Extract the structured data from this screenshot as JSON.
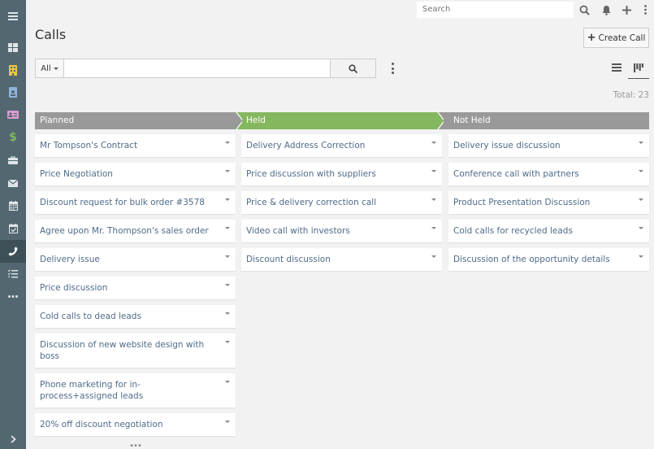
{
  "sidebar": {
    "menu_icon": "hamburger-icon",
    "items": [
      {
        "name": "dashboard",
        "icon": "dashboard-icon",
        "color": "#dfe5e8"
      },
      {
        "name": "accounts",
        "icon": "building-icon",
        "color": "#e8c34a"
      },
      {
        "name": "contacts",
        "icon": "contact-badge-icon",
        "color": "#8fb5dd"
      },
      {
        "name": "leads",
        "icon": "id-card-icon",
        "color": "#d99bd0"
      },
      {
        "name": "opportunities",
        "icon": "dollar-icon",
        "color": "#7fb85e"
      },
      {
        "name": "cases",
        "icon": "briefcase-icon",
        "color": "#dfe5e8"
      },
      {
        "name": "emails",
        "icon": "envelope-icon",
        "color": "#dfe5e8"
      },
      {
        "name": "calendar",
        "icon": "calendar-icon",
        "color": "#dfe5e8"
      },
      {
        "name": "meetings",
        "icon": "calendar-check-icon",
        "color": "#dfe5e8"
      },
      {
        "name": "calls",
        "icon": "phone-icon",
        "color": "#ffffff",
        "active": true
      },
      {
        "name": "tasks",
        "icon": "task-list-icon",
        "color": "#dfe5e8"
      },
      {
        "name": "more",
        "icon": "more-icon",
        "color": "#dfe5e8"
      }
    ],
    "expand_icon": "chevron-right-icon"
  },
  "topbar": {
    "search_placeholder": "Search",
    "icons": [
      "search-icon",
      "bell-icon",
      "plus-icon",
      "kebab-icon"
    ]
  },
  "header": {
    "title": "Calls",
    "create_button": "Create Call"
  },
  "filter": {
    "scope_label": "All",
    "search_value": ""
  },
  "summary": {
    "total_label": "Total:",
    "total_value": "23"
  },
  "colors": {
    "held_stage": "#85b75f",
    "stage_gray": "#999999",
    "card_text": "#4f6b8a",
    "sidebar_bg": "#536771"
  },
  "columns": [
    {
      "label": "Planned",
      "cards": [
        "Mr Tompson's Contract",
        "Price Negotiation",
        "Discount request for bulk order #3578",
        "Agree upon Mr. Thompson's sales order",
        "Delivery issue",
        "Price discussion",
        "Cold calls to dead leads",
        "Discussion of new website design with boss",
        "Phone marketing for in-process+assigned leads",
        "20% off discount negotiation"
      ],
      "show_more": "•••"
    },
    {
      "label": "Held",
      "cards": [
        "Delivery Address Correction",
        "Price discussion with suppliers",
        "Price & delivery correction call",
        "Video call with investors",
        "Discount discussion"
      ]
    },
    {
      "label": "Not Held",
      "cards": [
        "Delivery issue discussion",
        "Conference call with partners",
        "Product Presentation Discussion",
        "Cold calls for recycled leads",
        "Discussion of the opportunity details"
      ]
    }
  ]
}
